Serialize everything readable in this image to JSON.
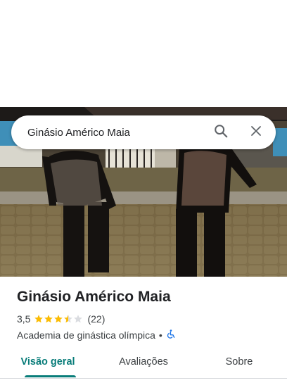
{
  "search": {
    "query": "Ginásio Américo Maia",
    "search_icon": "search-icon",
    "close_icon": "close-icon"
  },
  "photo": {
    "description_icon": "place-photo"
  },
  "place": {
    "title": "Ginásio Américo Maia",
    "rating": "3,5",
    "rating_fraction": 0.7,
    "stars_total": 5,
    "review_count": "(22)",
    "category": "Academia de ginástica olímpica",
    "separator": "•",
    "accessibility_icon": "wheelchair-icon"
  },
  "tabs": [
    {
      "label": "Visão geral",
      "active": true
    },
    {
      "label": "Avaliações",
      "active": false
    },
    {
      "label": "Sobre",
      "active": false
    }
  ],
  "colors": {
    "accent": "#087c79",
    "star": "#fbbc04",
    "star_empty": "#dadce0",
    "accessibility": "#1a73e8"
  }
}
